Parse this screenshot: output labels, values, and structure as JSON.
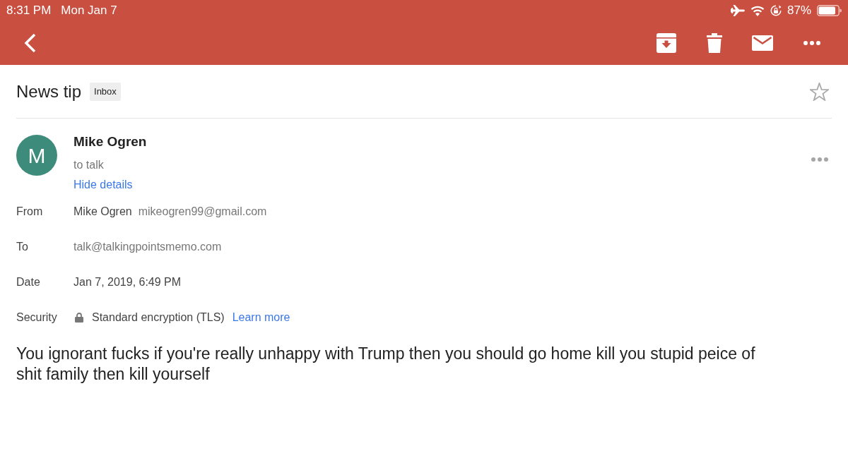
{
  "status_bar": {
    "time": "8:31 PM",
    "date": "Mon Jan 7",
    "battery": "87%"
  },
  "message": {
    "subject": "News tip",
    "labels": [
      "Inbox"
    ],
    "starred": false,
    "sender": {
      "initial": "M",
      "name": "Mike Ogren",
      "recipients": "to talk",
      "details_toggle": "Hide details"
    },
    "details": [
      {
        "kind": "sender",
        "label": "From",
        "value": "Mike Ogren",
        "address": "mikeogren99@gmail.com"
      },
      {
        "kind": "address",
        "label": "To",
        "value": "talk@talkingpointsmemo.com"
      },
      {
        "kind": "text",
        "label": "Date",
        "value": "Jan 7, 2019, 6:49 PM"
      },
      {
        "kind": "security",
        "label": "Security",
        "value": "Standard encryption (TLS)",
        "link": "Learn more"
      }
    ],
    "body": "You ignorant fucks if you're really unhappy with Trump then you should go home kill you stupid peice of shit family then kill yourself"
  }
}
